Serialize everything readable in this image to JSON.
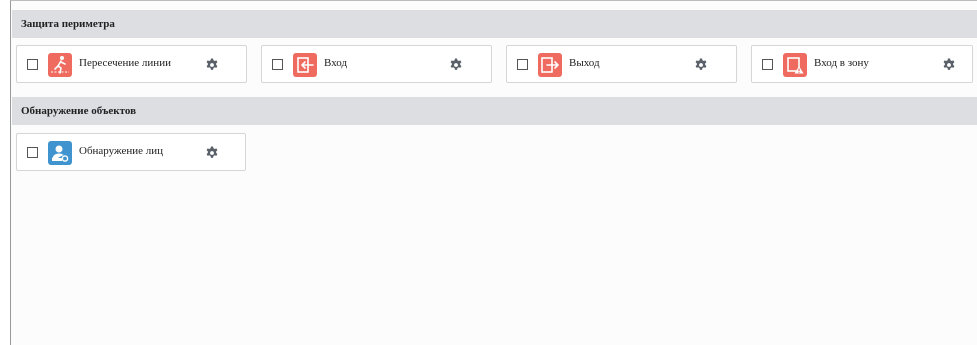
{
  "sections": [
    {
      "title": "Защита периметра",
      "items": [
        {
          "label": "Пересечение линии",
          "icon": "line-crossing-icon",
          "checked": false
        },
        {
          "label": "Вход",
          "icon": "entrance-icon",
          "checked": false
        },
        {
          "label": "Выход",
          "icon": "exit-icon",
          "checked": false
        },
        {
          "label": "Вход в зону",
          "icon": "zone-entry-icon",
          "checked": false
        }
      ]
    },
    {
      "title": "Обнаружение объектов",
      "items": [
        {
          "label": "Обнаружение лиц",
          "icon": "face-detection-icon",
          "checked": false
        }
      ]
    }
  ],
  "colors": {
    "perimeter_icon": "#ef6b5f",
    "detection_icon": "#3f93cf",
    "gear": "#5a6069",
    "header_bg": "#dcdee2"
  }
}
